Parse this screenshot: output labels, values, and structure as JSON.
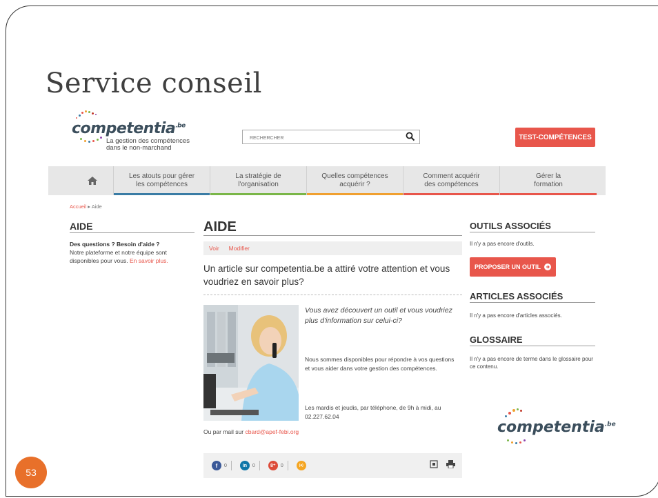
{
  "slide": {
    "title": "Service conseil",
    "page_number": "53"
  },
  "header": {
    "logo_text": "competentia",
    "logo_suffix": ".be",
    "tagline": "La gestion des compétences dans le non-marchand",
    "search_placeholder": "RECHERCHER",
    "test_button": "TEST-COMPÉTENCES"
  },
  "nav": {
    "items": [
      {
        "label": "Les atouts pour gérer les compétences",
        "color": "#3a7ca5"
      },
      {
        "label": "La stratégie de l'organisation",
        "color": "#7ab648"
      },
      {
        "label": "Quelles compétences acquérir ?",
        "color": "#f0a030"
      },
      {
        "label": "Comment acquérir des compétences",
        "color": "#e8564b"
      },
      {
        "label": "Gérer la formation",
        "color": "#e8564b"
      }
    ]
  },
  "breadcrumb": {
    "home": "Accueil",
    "separator": "▸",
    "current": "Aide"
  },
  "left": {
    "heading": "AIDE",
    "bold_line": "Des questions ? Besoin d'aide ?",
    "text": "Notre plateforme et notre équipe sont disponibles pour vous.",
    "link": "En savoir plus."
  },
  "main": {
    "heading": "AIDE",
    "tabs": [
      "Voir",
      "Modifier"
    ],
    "lead": "Un article sur competentia.be a attiré votre attention et vous voudriez en savoir plus?",
    "question": "Vous avez découvert un outil et vous voudriez plus d'information sur celui-ci?",
    "para1": "Nous sommes disponibles pour répondre à vos questions et vous aider dans votre gestion des compétences.",
    "para2": "Les mardis et jeudis, par téléphone, de 9h à midi, au 02.227.62.04",
    "mail_prefix": "Ou par mail sur",
    "mail_link": "cbard@apef-febi.org"
  },
  "share": [
    {
      "glyph": "f",
      "count": "0",
      "color": "#3b5998"
    },
    {
      "glyph": "in",
      "count": "0",
      "color": "#0e76a8"
    },
    {
      "glyph": "8⁺",
      "count": "0",
      "color": "#dd4b39"
    },
    {
      "glyph": "(a)",
      "count": "",
      "color": "#f5a623"
    }
  ],
  "right": {
    "tools_heading": "OUTILS ASSOCIÉS",
    "tools_text": "Il n'y a pas encore d'outils.",
    "propose_button": "PROPOSER UN OUTIL",
    "articles_heading": "ARTICLES ASSOCIÉS",
    "articles_text": "Il n'y a pas encore d'articles associés.",
    "glossary_heading": "GLOSSAIRE",
    "glossary_text": "Il n'y a pas encore de terme dans le glossaire pour ce contenu."
  },
  "colors": {
    "accent": "#e8564b",
    "slide_number_bg": "#e8702a"
  }
}
